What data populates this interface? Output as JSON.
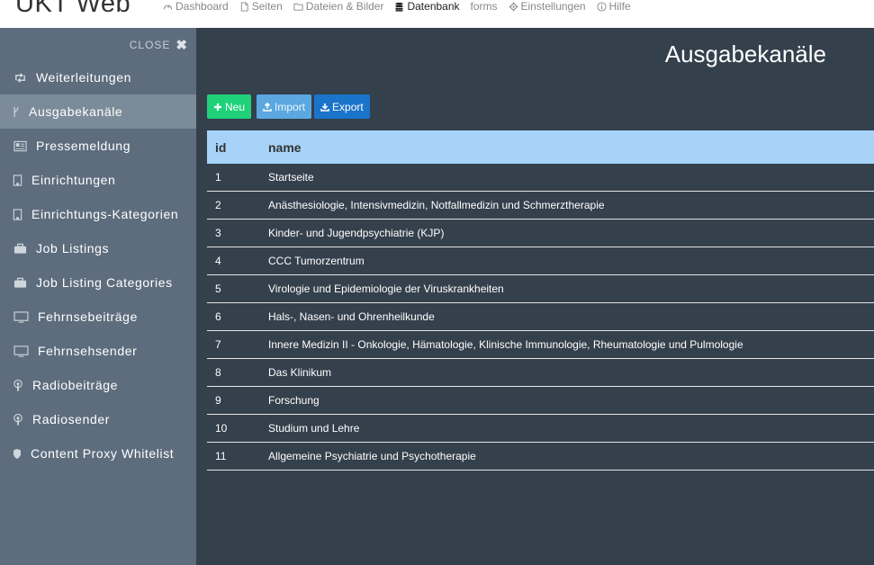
{
  "app": {
    "title": "UKT Web"
  },
  "topnav": [
    {
      "label": "Dashboard",
      "icon": "dashboard-icon",
      "active": false
    },
    {
      "label": "Seiten",
      "icon": "page-icon",
      "active": false
    },
    {
      "label": "Dateien & Bilder",
      "icon": "folder-icon",
      "active": false
    },
    {
      "label": "Datenbank",
      "icon": "database-icon",
      "active": true
    },
    {
      "label": "forms",
      "icon": "",
      "active": false
    },
    {
      "label": "Einstellungen",
      "icon": "gear-icon",
      "active": false
    },
    {
      "label": "Hilfe",
      "icon": "info-icon",
      "active": false
    }
  ],
  "sidebar": {
    "close_label": "CLOSE",
    "items": [
      {
        "label": "Weiterleitungen",
        "icon": "retweet-icon",
        "active": false
      },
      {
        "label": "Ausgabekanäle",
        "icon": "fork-icon",
        "active": true
      },
      {
        "label": "Pressemeldung",
        "icon": "newspaper-icon",
        "active": false
      },
      {
        "label": "Einrichtungen",
        "icon": "building-icon",
        "active": false
      },
      {
        "label": "Einrichtungs-Kategorien",
        "icon": "building-icon",
        "active": false
      },
      {
        "label": "Job Listings",
        "icon": "briefcase-icon",
        "active": false
      },
      {
        "label": "Job Listing Categories",
        "icon": "briefcase-icon",
        "active": false
      },
      {
        "label": "Fehrnsebeiträge",
        "icon": "monitor-icon",
        "active": false
      },
      {
        "label": "Fehrnsehsender",
        "icon": "monitor-icon",
        "active": false
      },
      {
        "label": "Radiobeiträge",
        "icon": "podcast-icon",
        "active": false
      },
      {
        "label": "Radiosender",
        "icon": "podcast-icon",
        "active": false
      },
      {
        "label": "Content Proxy Whitelist",
        "icon": "shield-icon",
        "active": false
      }
    ]
  },
  "main": {
    "title": "Ausgabekanäle",
    "buttons": {
      "new": "Neu",
      "import": "Import",
      "export": "Export"
    },
    "colors": {
      "new": "#1fd27a",
      "import": "#5ba8e0",
      "export": "#1a74c9",
      "header": "#a7d3f8"
    },
    "table": {
      "headers": {
        "id": "id",
        "name": "name"
      },
      "rows": [
        {
          "id": "1",
          "name": "Startseite"
        },
        {
          "id": "2",
          "name": "Anästhesiologie, Intensivmedizin, Notfallmedizin und Schmerztherapie"
        },
        {
          "id": "3",
          "name": "Kinder- und Jugendpsychiatrie (KJP)"
        },
        {
          "id": "4",
          "name": "CCC Tumorzentrum"
        },
        {
          "id": "5",
          "name": "Virologie und Epidemiologie der Viruskrankheiten"
        },
        {
          "id": "6",
          "name": "Hals-, Nasen- und Ohrenheilkunde"
        },
        {
          "id": "7",
          "name": "Innere Medizin II - Onkologie, Hämatologie, Klinische Immunologie, Rheumatologie und Pulmologie"
        },
        {
          "id": "8",
          "name": "Das Klinikum"
        },
        {
          "id": "9",
          "name": "Forschung"
        },
        {
          "id": "10",
          "name": "Studium und Lehre"
        },
        {
          "id": "11",
          "name": "Allgemeine Psychiatrie und Psychotherapie"
        }
      ]
    }
  }
}
